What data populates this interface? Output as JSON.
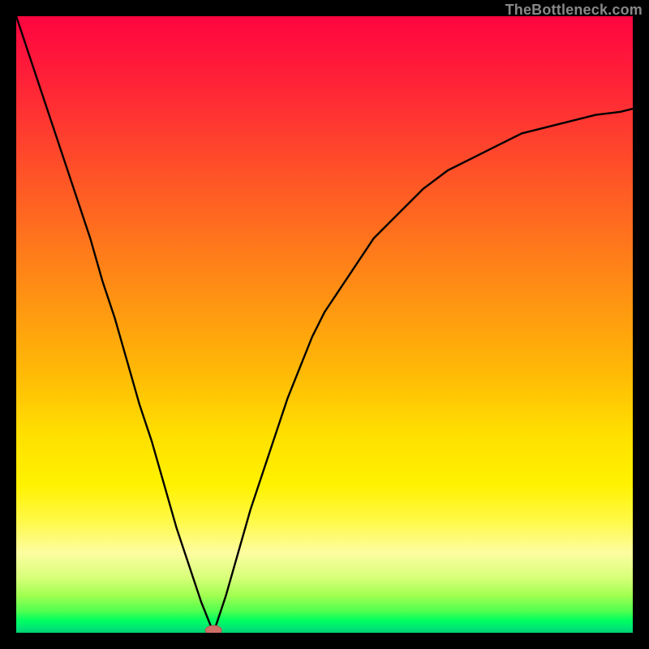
{
  "watermark": "TheBottleneck.com",
  "colors": {
    "frame": "#000000",
    "curve": "#000000",
    "marker_fill": "#cc6f66",
    "marker_stroke": "#b35a52",
    "gradient_stops": [
      "#ff0540",
      "#ff3a30",
      "#ff7a1b",
      "#ffba06",
      "#fff200",
      "#fdfda0",
      "#a0ff50",
      "#00ff60",
      "#00d070"
    ]
  },
  "chart_data": {
    "type": "line",
    "title": "",
    "xlabel": "",
    "ylabel": "",
    "xlim": [
      0,
      1
    ],
    "ylim": [
      0,
      1
    ],
    "grid": false,
    "legend": false,
    "minimum_marker": {
      "x": 0.32,
      "y": 0.0,
      "r": 0.012
    },
    "x": [
      0.0,
      0.02,
      0.04,
      0.06,
      0.08,
      0.1,
      0.12,
      0.14,
      0.16,
      0.18,
      0.2,
      0.22,
      0.24,
      0.26,
      0.28,
      0.3,
      0.31,
      0.32,
      0.33,
      0.34,
      0.36,
      0.38,
      0.4,
      0.42,
      0.44,
      0.46,
      0.48,
      0.5,
      0.54,
      0.58,
      0.62,
      0.66,
      0.7,
      0.74,
      0.78,
      0.82,
      0.86,
      0.9,
      0.94,
      0.98,
      1.0
    ],
    "y": [
      1.0,
      0.94,
      0.88,
      0.82,
      0.76,
      0.7,
      0.64,
      0.57,
      0.51,
      0.44,
      0.37,
      0.31,
      0.24,
      0.17,
      0.11,
      0.05,
      0.025,
      0.0,
      0.03,
      0.06,
      0.13,
      0.2,
      0.26,
      0.32,
      0.38,
      0.43,
      0.48,
      0.52,
      0.58,
      0.64,
      0.68,
      0.72,
      0.75,
      0.77,
      0.79,
      0.81,
      0.82,
      0.83,
      0.84,
      0.845,
      0.85
    ]
  }
}
